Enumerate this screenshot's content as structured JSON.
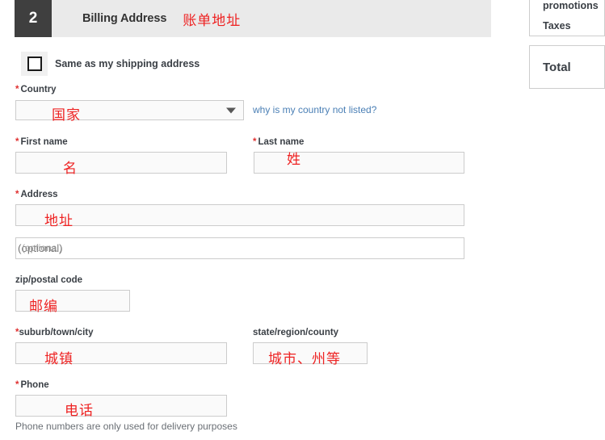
{
  "step": {
    "number": "2",
    "title": "Billing Address",
    "title_annotation": "账单地址"
  },
  "checkbox": {
    "label": "Same as my shipping address",
    "checked": false
  },
  "fields": {
    "country": {
      "label": "Country",
      "required": true,
      "value": "",
      "annotation": "国家",
      "help_link": "why is my country not listed?"
    },
    "first_name": {
      "label": "First name",
      "required": true,
      "value": "",
      "annotation": "名"
    },
    "last_name": {
      "label": "Last name",
      "required": true,
      "value": "",
      "annotation": "姓"
    },
    "address": {
      "label": "Address",
      "required": true,
      "value": "",
      "annotation": "地址"
    },
    "address2": {
      "label": "",
      "required": false,
      "value": "",
      "placeholder": "(optional)"
    },
    "zip": {
      "label": "zip/postal code",
      "required": false,
      "value": "",
      "annotation": "邮编"
    },
    "suburb": {
      "label": "suburb/town/city",
      "required": true,
      "value": "",
      "annotation": "城镇"
    },
    "state": {
      "label": "state/region/county",
      "required": false,
      "value": "",
      "annotation": "城市、州等"
    },
    "phone": {
      "label": "Phone",
      "required": true,
      "value": "",
      "annotation": "电话",
      "helper_text": "Phone numbers are only used for delivery purposes"
    }
  },
  "summary": {
    "promotions": "promotions",
    "taxes": "Taxes",
    "total": "Total"
  },
  "colors": {
    "accent_red": "#ee2222",
    "required_star": "#e03030",
    "link_blue": "#4a7fb5",
    "step_box": "#3f3f3f",
    "header_bg": "#eaeaea"
  },
  "icons": {
    "dropdown": "chevron-down-icon",
    "checkbox": "checkbox-icon"
  }
}
